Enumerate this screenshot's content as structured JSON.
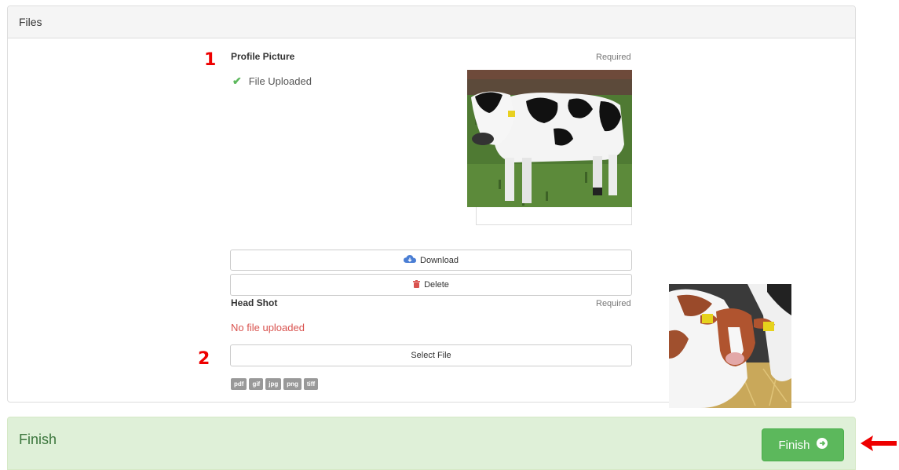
{
  "files_panel": {
    "title": "Files"
  },
  "profile_picture": {
    "label": "Profile Picture",
    "required": "Required",
    "status": "File Uploaded",
    "download_label": "Download",
    "delete_label": "Delete"
  },
  "head_shot": {
    "label": "Head Shot",
    "required": "Required",
    "status": "No file uploaded",
    "select_label": "Select File",
    "file_types": [
      "pdf",
      "gif",
      "jpg",
      "png",
      "tiff"
    ]
  },
  "markers": {
    "one": "1",
    "two": "2"
  },
  "finish_panel": {
    "title": "Finish",
    "button_label": "Finish"
  },
  "colors": {
    "success": "#5cb85c",
    "danger": "#d9534f",
    "finish_bg": "#dff0d8",
    "annotation_red": "#ee0000"
  },
  "icons": {
    "check": "check-icon",
    "download": "cloud-download-icon",
    "delete": "trash-icon",
    "finish": "arrow-circle-right-icon",
    "annotation": "red-arrow-icon"
  }
}
